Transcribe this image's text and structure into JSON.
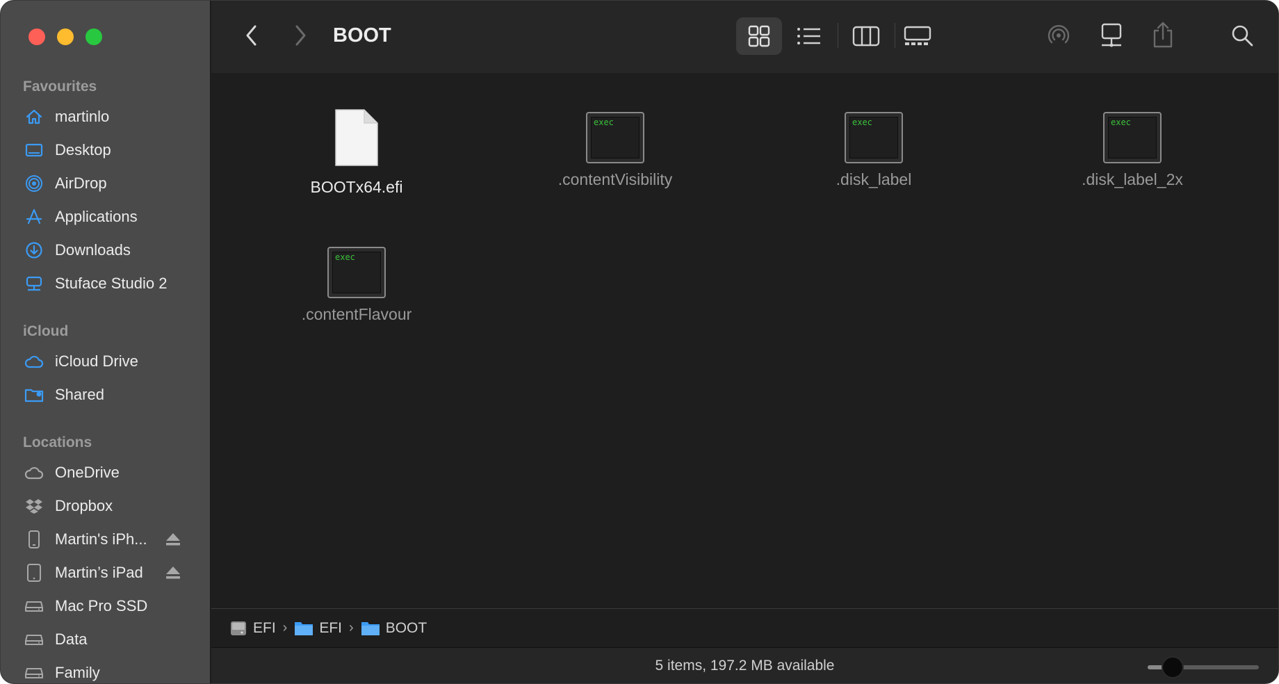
{
  "window": {
    "title": "BOOT"
  },
  "sidebar": {
    "favourites_header": "Favourites",
    "favourites": [
      {
        "label": "martinlo",
        "icon": "home-icon"
      },
      {
        "label": "Desktop",
        "icon": "desktop-icon"
      },
      {
        "label": "AirDrop",
        "icon": "airdrop-icon"
      },
      {
        "label": "Applications",
        "icon": "applications-icon"
      },
      {
        "label": "Downloads",
        "icon": "downloads-icon"
      },
      {
        "label": "Stuface Studio 2",
        "icon": "network-drive-icon"
      }
    ],
    "icloud_header": "iCloud",
    "icloud": [
      {
        "label": "iCloud Drive",
        "icon": "cloud-icon"
      },
      {
        "label": "Shared",
        "icon": "shared-folder-icon"
      }
    ],
    "locations_header": "Locations",
    "locations": [
      {
        "label": "OneDrive",
        "icon": "cloud-icon"
      },
      {
        "label": "Dropbox",
        "icon": "dropbox-icon"
      },
      {
        "label": "Martin's iPh...",
        "icon": "iphone-icon",
        "eject": true
      },
      {
        "label": "Martin’s iPad",
        "icon": "ipad-icon",
        "eject": true
      },
      {
        "label": "Mac Pro SSD",
        "icon": "drive-icon"
      },
      {
        "label": "Data",
        "icon": "drive-icon"
      },
      {
        "label": "Family",
        "icon": "drive-icon"
      }
    ]
  },
  "files": [
    {
      "name": "BOOTx64.efi",
      "kind": "document",
      "hidden": false
    },
    {
      "name": ".contentVisibility",
      "kind": "exec",
      "hidden": true
    },
    {
      "name": ".disk_label",
      "kind": "exec",
      "hidden": true
    },
    {
      "name": ".disk_label_2x",
      "kind": "exec",
      "hidden": true
    },
    {
      "name": ".contentFlavour",
      "kind": "exec",
      "hidden": true
    }
  ],
  "exec_badge": "exec",
  "pathbar": [
    {
      "label": "EFI",
      "icon": "drive-icon"
    },
    {
      "label": "EFI",
      "icon": "folder-icon"
    },
    {
      "label": "BOOT",
      "icon": "folder-icon"
    }
  ],
  "status": {
    "text": "5 items, 197.2 MB available",
    "icon_size_fraction": 0.15
  },
  "colors": {
    "accent": "#3b9bf5",
    "close": "#fe5f57",
    "minimize": "#febc2e",
    "maximize": "#28c840"
  }
}
